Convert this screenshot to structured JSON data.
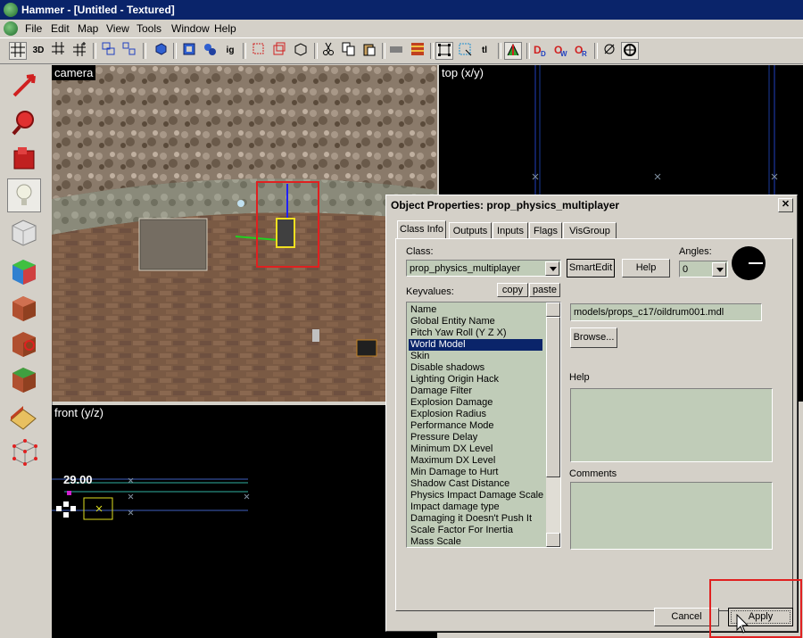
{
  "window": {
    "title": "Hammer - [Untitled - Textured]"
  },
  "menu": [
    "File",
    "Edit",
    "Map",
    "View",
    "Tools",
    "Window",
    "Help"
  ],
  "toolbar": {
    "icons": [
      "grid-icon",
      "3d-grid-icon",
      "grid-smaller-icon",
      "grid-larger-icon",
      "group-icon",
      "ungroup-icon",
      "carve-icon",
      "hollow-icon",
      "ignore-groups-icon",
      "toggle-selection-icon",
      "texture-lock-icon",
      "cut-icon",
      "copy-icon",
      "paste-icon",
      "hide-icon",
      "texture-app-icon",
      "decal-icon",
      "select-box-icon",
      "select-handles-icon",
      "texture-label-icon",
      "clip-icon",
      "run-map-icon",
      "vmf-icon",
      "vw-icon",
      "vr-icon",
      "radar-icon",
      "settings-icon"
    ],
    "labels": {
      "3d": "3D",
      "ig": "ig",
      "tl": "tl"
    }
  },
  "viewports": {
    "camera": "camera",
    "top": "top (x/y)",
    "front": "front (y/z)",
    "front_value": "29.00"
  },
  "dialog": {
    "title": "Object Properties: prop_physics_multiplayer",
    "tabs": [
      "Class Info",
      "Outputs",
      "Inputs",
      "Flags",
      "VisGroup"
    ],
    "class_label": "Class:",
    "class_value": "prop_physics_multiplayer",
    "smartedit": "SmartEdit",
    "help_button": "Help",
    "angles_label": "Angles:",
    "angles_value": "0",
    "keyvalues_label": "Keyvalues:",
    "copy": "copy",
    "paste": "paste",
    "keyvalues": [
      "Name",
      "Global Entity Name",
      "Pitch Yaw Roll (Y Z X)",
      "World Model",
      "Skin",
      "Disable shadows",
      "Lighting Origin Hack",
      "Damage Filter",
      "Explosion Damage",
      "Explosion Radius",
      "Performance Mode",
      "Pressure Delay",
      "Minimum DX Level",
      "Maximum DX Level",
      "Min Damage to Hurt",
      "Shadow Cast Distance",
      "Physics Impact Damage Scale",
      "Impact damage type",
      "Damaging it Doesn't Push It",
      "Scale Factor For Inertia",
      "Mass Scale"
    ],
    "selected_key": "World Model",
    "value": "models/props_c17/oildrum001.mdl",
    "browse": "Browse...",
    "help_label": "Help",
    "comments_label": "Comments",
    "cancel": "Cancel",
    "apply": "Apply"
  },
  "colors": {
    "titlebar": "#0a246a",
    "face": "#d4d0c8",
    "field": "#c0ccb8",
    "highlight_box": "#e02020",
    "grid_line": "#1a3a9a"
  }
}
